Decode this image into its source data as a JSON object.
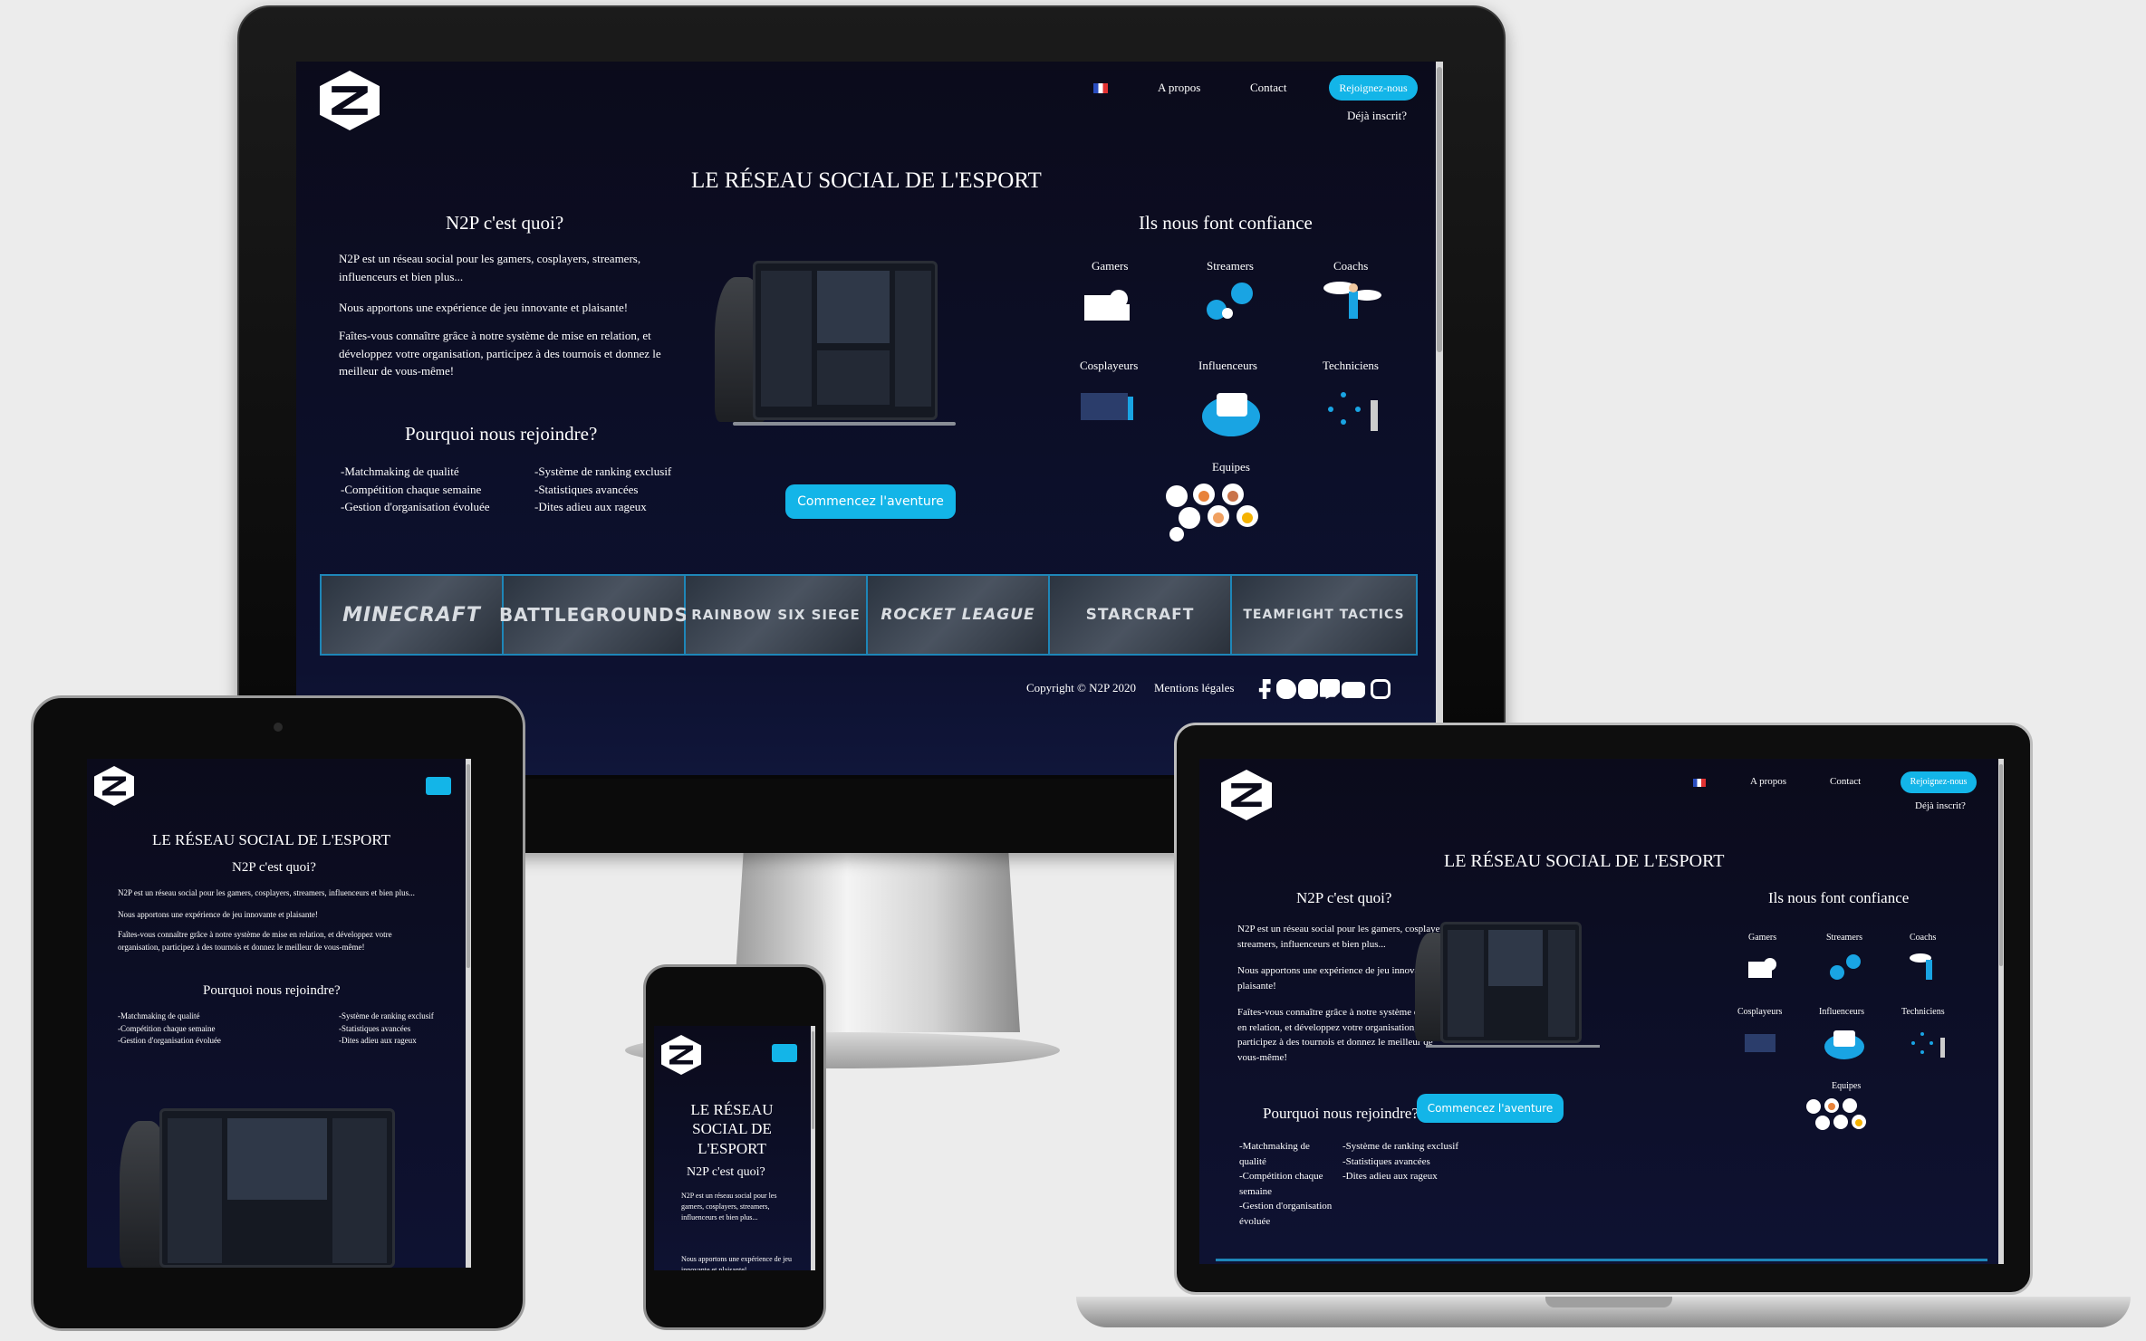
{
  "nav": {
    "about": "A propos",
    "contact": "Contact",
    "join": "Rejoignez-nous",
    "already": "Déjà inscrit?"
  },
  "hero": {
    "title": "LE RÉSEAU SOCIAL DE L'ESPORT",
    "title_phone_lines": [
      "LE RÉSEAU",
      "SOCIAL DE",
      "L'ESPORT"
    ],
    "what_title": "N2P c'est quoi?",
    "p1": "N2P est un réseau social pour les gamers, cosplayers, streamers, influenceurs et bien plus...",
    "p1_lines": [
      "N2P est un réseau social pour les gamers, cosplayers, streamers,",
      "influenceurs et bien plus..."
    ],
    "p2": "Nous apportons une expérience de jeu innovante et plaisante!",
    "p3": "Faîtes-vous connaître grâce à notre système de mise en relation, et développez votre organisation, participez à des tournois et donnez le meilleur de vous-même!",
    "p3_lines": [
      "Faîtes-vous connaître grâce à notre système de mise en relation, et",
      "développez votre organisation, participez à des tournois et donnez le",
      "meilleur de vous-même!"
    ],
    "why_title": "Pourquoi nous rejoindre?",
    "reasons_left": [
      "-Matchmaking de qualité",
      "-Compétition chaque semaine",
      "-Gestion d'organisation évoluée"
    ],
    "reasons_right": [
      "-Système de ranking exclusif",
      "-Statistiques avancées",
      "-Dites adieu aux rageux"
    ],
    "cta": "Commencez l'aventure"
  },
  "trust": {
    "title": "Ils nous font confiance",
    "personas": [
      "Gamers",
      "Streamers",
      "Coachs",
      "Cosplayeurs",
      "Influenceurs",
      "Techniciens",
      "Equipes"
    ]
  },
  "games": [
    "MINECRAFT",
    "BATTLEGROUNDS",
    "RAINBOW SIX SIEGE",
    "ROCKET LEAGUE",
    "STARCRAFT",
    "TEAMFIGHT TACTICS"
  ],
  "footer": {
    "copyright": "Copyright © N2P 2020",
    "legal": "Mentions légales",
    "social_icons": [
      "facebook-icon",
      "twitter-icon",
      "discord-icon",
      "twitch-icon",
      "youtube-icon",
      "instagram-icon"
    ]
  },
  "colors": {
    "accent": "#13b5e8",
    "background": "#0b0b1b",
    "frame_border": "#1e86b8"
  }
}
